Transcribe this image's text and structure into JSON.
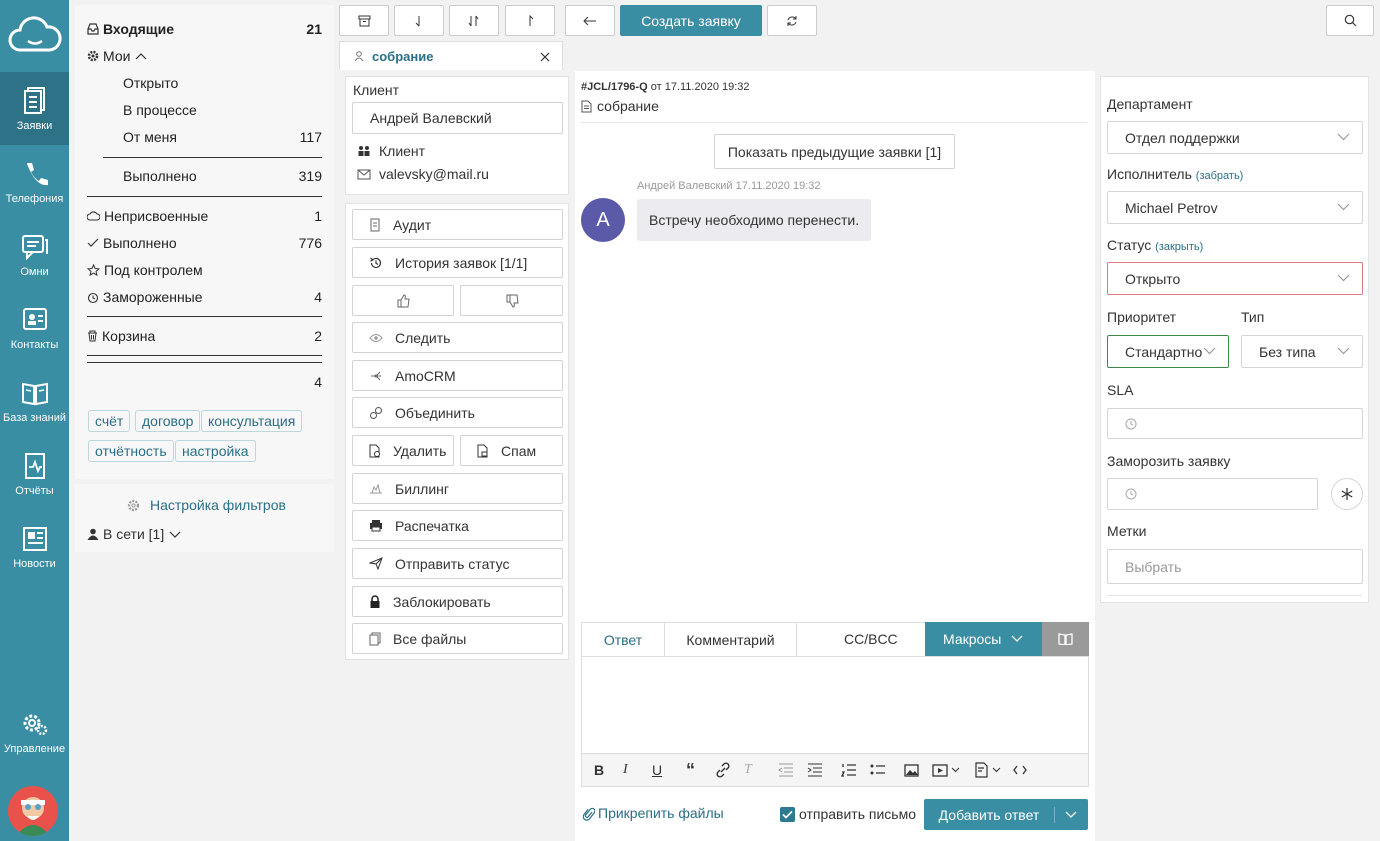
{
  "nav": {
    "items": [
      {
        "label": "Заявки",
        "icon": "tickets-icon"
      },
      {
        "label": "Телефония",
        "icon": "phone-icon"
      },
      {
        "label": "Омни",
        "icon": "chat-icon"
      },
      {
        "label": "Контакты",
        "icon": "contacts-icon"
      },
      {
        "label": "База знаний",
        "icon": "book-icon"
      },
      {
        "label": "Отчёты",
        "icon": "report-icon"
      },
      {
        "label": "Новости",
        "icon": "news-icon"
      },
      {
        "label": "Управление",
        "icon": "gears-icon"
      }
    ]
  },
  "folders": {
    "inbox": {
      "label": "Входящие",
      "count": "21"
    },
    "mine": {
      "label": "Мои"
    },
    "open": {
      "label": "Открыто"
    },
    "in_progress": {
      "label": "В процессе"
    },
    "from_me": {
      "label": "От меня",
      "count": "117"
    },
    "done_mine": {
      "label": "Выполнено",
      "count": "319"
    },
    "unassigned": {
      "label": "Неприсвоенные",
      "count": "1"
    },
    "done": {
      "label": "Выполнено",
      "count": "776"
    },
    "watched": {
      "label": "Под контролем"
    },
    "frozen": {
      "label": "Замороженные",
      "count": "4"
    },
    "trash": {
      "label": "Корзина",
      "count": "2"
    },
    "extra_count": "4",
    "tags": [
      "счёт",
      "договор",
      "консультация",
      "отчётность",
      "настройка"
    ]
  },
  "filters": {
    "settings_label": "Настройка фильтров",
    "online_label": "В сети [1]"
  },
  "toolbar": {
    "create_label": "Создать заявку"
  },
  "tab": {
    "title": "собрание"
  },
  "client": {
    "section_label": "Клиент",
    "name": "Андрей Валевский",
    "role": "Клиент",
    "email": "valevsky@mail.ru"
  },
  "actions": {
    "audit": "Аудит",
    "history": "История заявок [1/1]",
    "follow": "Следить",
    "amocrm": "AmoCRM",
    "merge": "Объединить",
    "delete": "Удалить",
    "spam": "Спам",
    "billing": "Биллинг",
    "print": "Распечатка",
    "send_status": "Отправить статус",
    "block": "Заблокировать",
    "all_files": "Все файлы"
  },
  "ticket": {
    "id": "#JCL/1796-Q",
    "from_word": "от",
    "date": "17.11.2020 19:32",
    "subject": "собрание",
    "show_prev": "Показать предыдущие заявки [1]",
    "message": {
      "author": "Андрей Валевский",
      "time": "17.11.2020 19:32",
      "avatar_letter": "A",
      "text": "Встречу необходимо перенести."
    }
  },
  "reply": {
    "tab_answer": "Ответ",
    "tab_comment": "Комментарий",
    "cc": "CC/BCC",
    "macros": "Макросы",
    "attach": "Прикрепить файлы",
    "send_mail": "отправить письмо",
    "add_reply": "Добавить ответ"
  },
  "props": {
    "department_label": "Департамент",
    "department_value": "Отдел поддержки",
    "assignee_label": "Исполнитель",
    "assignee_link": "(забрать)",
    "assignee_value": "Michael Petrov",
    "status_label": "Статус",
    "status_link": "(закрыть)",
    "status_value": "Открыто",
    "priority_label": "Приоритет",
    "priority_value": "Стандартно",
    "type_label": "Тип",
    "type_value": "Без типа",
    "sla_label": "SLA",
    "freeze_label": "Заморозить заявку",
    "tags_label": "Метки",
    "tags_placeholder": "Выбрать"
  },
  "colors": {
    "accent": "#3a8ea3",
    "nav_active": "#2d7287",
    "status_border": "#e07a80",
    "priority_border": "#3c8a4a",
    "avatar": "#5a5aa8"
  }
}
